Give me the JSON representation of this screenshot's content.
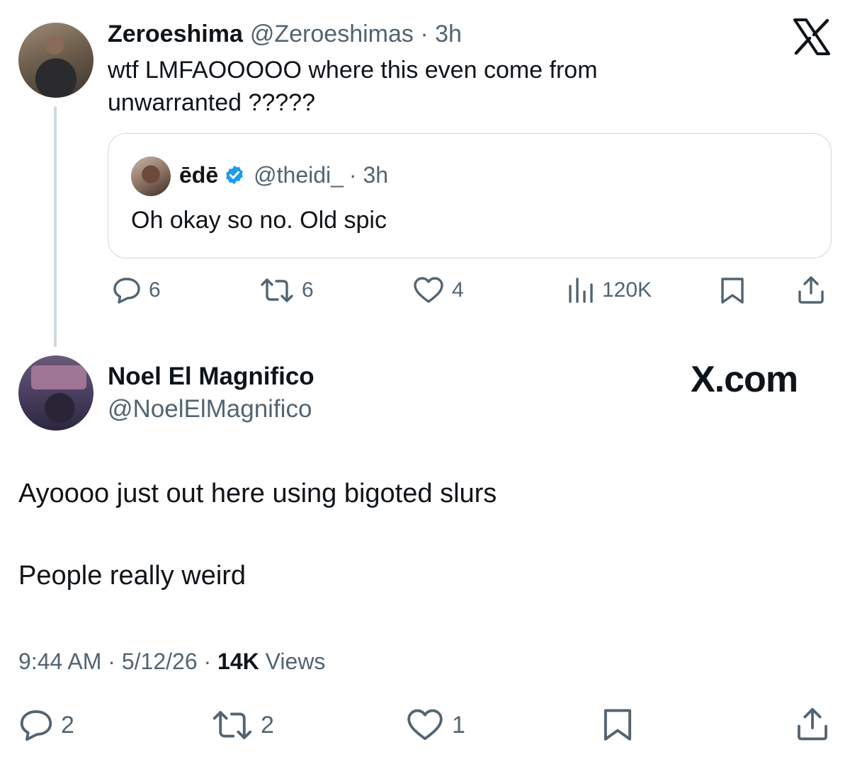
{
  "parent_tweet": {
    "author_name": "Zeroeshima",
    "author_handle": "@Zeroeshimas",
    "time": "· 3h",
    "text_line_1": "wtf LMFAOOOOO where this even come from",
    "text_line_2": "unwarranted ?????",
    "quote": {
      "author_name": "ēdē",
      "author_handle": "@theidi_",
      "time": "· 3h",
      "text": "Oh okay so no. Old spic"
    },
    "actions": {
      "replies": "6",
      "reposts": "6",
      "likes": "4",
      "views": "120K"
    }
  },
  "main_tweet": {
    "author_name": "Noel El Magnifico",
    "author_handle": "@NoelElMagnifico",
    "body_line_1": "Ayoooo just out here using bigoted slurs",
    "body_line_2": "People really weird",
    "time": "9:44 AM",
    "date": "5/12/26",
    "views_count": "14K",
    "views_label": "Views",
    "actions": {
      "replies": "2",
      "reposts": "2",
      "likes": "1"
    }
  },
  "watermark": "X.com",
  "colors": {
    "text": "#0f1419",
    "muted": "#536471",
    "border": "#cfd9de",
    "verified": "#1d9bf0"
  }
}
